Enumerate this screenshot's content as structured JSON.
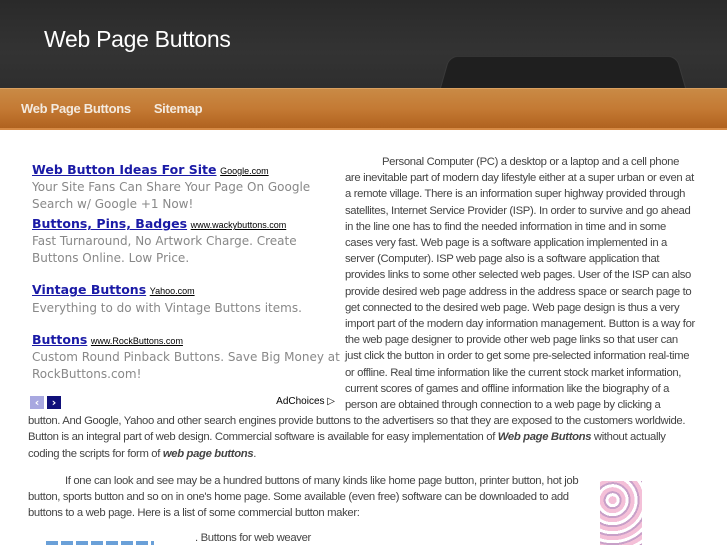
{
  "header": {
    "title": "Web Page Buttons"
  },
  "nav": [
    "Web Page Buttons",
    "Sitemap"
  ],
  "ads": [
    {
      "title": "Web Button Ideas For Site",
      "url": "Google.com",
      "desc": "Your Site Fans Can Share Your Page On Google Search w/ Google +1 Now!"
    },
    {
      "title": "Buttons, Pins, Badges",
      "url": "www.wackybuttons.com",
      "desc": "Fast Turnaround, No Artwork Charge. Create Buttons Online. Low Price."
    },
    {
      "title": "Vintage Buttons",
      "url": "Yahoo.com",
      "desc": "Everything to do with Vintage Buttons items."
    },
    {
      "title": "Buttons",
      "url": "www.RockButtons.com",
      "desc": "Custom Round Pinback Buttons. Save Big Money at RockButtons.com!"
    }
  ],
  "adchoices": "AdChoices ▷",
  "arrows": {
    "prev": "‹",
    "next": "›"
  },
  "article": {
    "p1": "Personal Computer (PC) a desktop or a laptop and a cell phone are inevitable part of modern day lifestyle either at a super urban or even at a remote village. There is an information super highway provided through satellites, Internet Service Provider (ISP). In order to survive and go ahead in the line one has to find the needed information in time and in some cases very fast. Web page is a software application implemented in a server (Computer). ISP web page also is a software application that provides links to some other selected web pages. User of the ISP can also provide desired web page address in the address space or search page to get connected to the desired web page. Web page design is thus a very import part of the modern day information management. Button is a way for the web page designer to provide other web page links so that user can just click the button in order to get some pre-selected information real-time or offline. Real time information like the current stock market information, current scores of games and offline information like the biography of a person are obtained through connection to a web page by clicking a button. And Google, Yahoo and other search engines provide buttons to the advertisers so that they are exposed to the customers worldwide. Button is an integral part of web design. Commercial software is available for easy implementation of ",
    "p1_bold1": "Web page Buttons",
    "p1_mid": " without actually coding the scripts for form of ",
    "p1_bold2": "web page buttons",
    "p1_end": ".",
    "p2": "If one can look and see may be a hundred buttons of many kinds like home page button, printer button, hot job button, sports button and so on in one's home page. Some available (even free) software can be downloaded to add buttons to a web page. Here is a list of some commercial button maker:",
    "item1": ". Buttons for web weaver"
  }
}
